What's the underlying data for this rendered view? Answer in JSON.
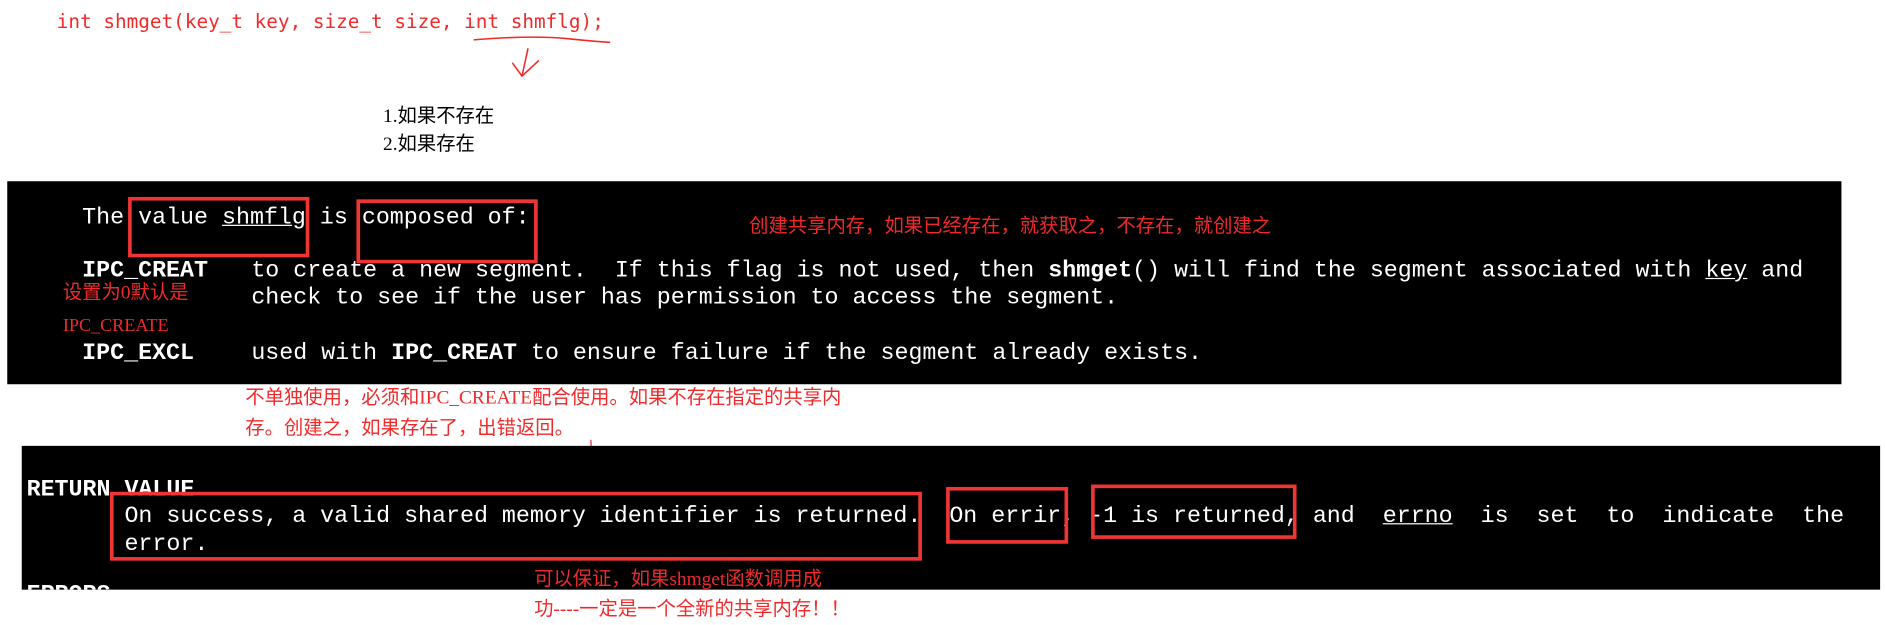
{
  "signature": "int shmget(key_t key, size_t size, int shmflg);",
  "cases": [
    "1.如果不存在",
    "2.如果存在"
  ],
  "man_flags": {
    "intro": {
      "pre": "The ",
      "value": "value ",
      "shmflg": "shmflg",
      "is": " is ",
      "composed": "composed of:"
    },
    "ipc_creat": {
      "name": "IPC_CREAT",
      "line1_a": "to create a new segment.  If this flag is not used, then ",
      "shmget": "shmget",
      "line1_b": "() will find the segment associated with ",
      "key": "key",
      "line1_c": " and",
      "line2": "check to see if the user has permission to access the segment."
    },
    "ipc_excl": {
      "name": "IPC_EXCL",
      "a": "used with ",
      "flag": "IPC_CREAT",
      "b": " to ensure failure if the segment already exists."
    }
  },
  "man_return": {
    "heading": "RETURN VALUE",
    "line1_a": "On success, a valid shared memory identifier is returned.  On errir, -1 is returned, and  ",
    "errno": "errno",
    "line1_b": "  is  set  to  indicate  the",
    "line2": "error.",
    "next_heading": "ERRORS"
  },
  "annotations": {
    "composed": "创建共享内存，如果已经存在，就获取之，不存在，就创建之",
    "default_1": "设置为0默认是",
    "default_2": "IPC_CREATE",
    "excl_1": "不单独使用，必须和IPC_CREATE配合使用。如果不存在指定的共享内",
    "excl_2": "存。创建之，如果存在了，出错返回。",
    "guarantee_1": "可以保证，如果shmget函数调用成",
    "guarantee_2": "功----一定是一个全新的共享内存！！"
  },
  "colors": {
    "annotation": "#f02a2a",
    "terminal_bg": "#000000",
    "terminal_fg": "#ffffff"
  }
}
